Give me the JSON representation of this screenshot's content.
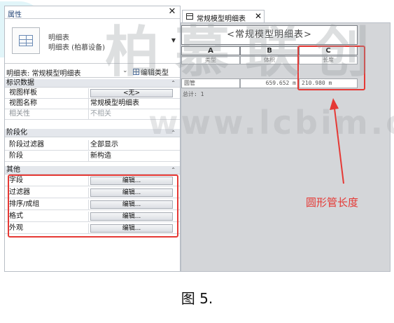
{
  "properties_panel": {
    "title": "属性",
    "close_glyph": "✕",
    "type_selector": {
      "line1": "明细表",
      "line2": "明细表 (柏慕设备)",
      "icon": "schedule-grid-icon"
    },
    "instance_label": "明细表: 常规模型明细表",
    "edit_type_label": "编辑类型",
    "groups": {
      "identity": "标识数据",
      "phasing": "阶段化",
      "other": "其他"
    },
    "identity_rows": [
      {
        "name": "视图样板",
        "value": "<无>"
      },
      {
        "name": "视图名称",
        "value": "常规模型明细表"
      },
      {
        "name": "相关性",
        "value": "不相关"
      }
    ],
    "phasing_rows": [
      {
        "name": "阶段过滤器",
        "value": "全部显示"
      },
      {
        "name": "阶段",
        "value": "新构造"
      }
    ],
    "other_rows": [
      {
        "name": "字段",
        "value": "编辑..."
      },
      {
        "name": "过滤器",
        "value": "编辑..."
      },
      {
        "name": "排序/成组",
        "value": "编辑..."
      },
      {
        "name": "格式",
        "value": "编辑..."
      },
      {
        "name": "外观",
        "value": "编辑..."
      }
    ]
  },
  "schedule_view": {
    "tab_label": "常规模型明细表",
    "tab_close": "✕",
    "title": "<常规模型明细表>",
    "columns": [
      {
        "letter": "A",
        "header": "类型"
      },
      {
        "letter": "B",
        "header": "体积"
      },
      {
        "letter": "C",
        "header": "长度"
      }
    ],
    "rows": [
      {
        "a": "圆管",
        "b": "659.652 m",
        "c": "210.980 m"
      }
    ],
    "total": "总计: 1"
  },
  "annotation": {
    "label": "圆形管长度",
    "color": "#e53935"
  },
  "watermark": {
    "brand": "柏慕联创",
    "url": "www.lcbim.com"
  },
  "caption": "图 5."
}
